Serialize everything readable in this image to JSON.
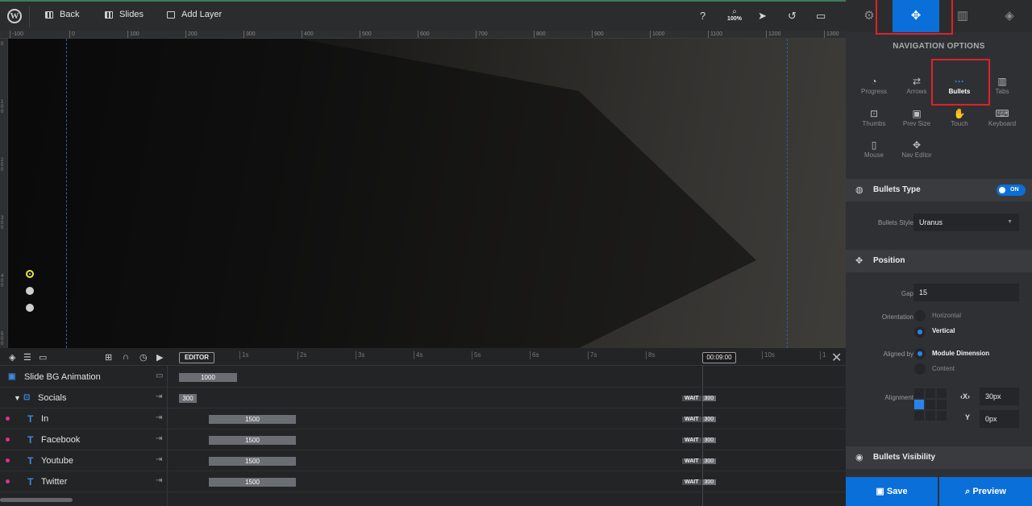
{
  "toolbar": {
    "wp_logo": "W",
    "back_label": "Back",
    "slides_label": "Slides",
    "add_layer_label": "Add Layer",
    "zoom_label": "100%"
  },
  "ruler": {
    "top_ticks": [
      "-100",
      "0",
      "100",
      "200",
      "300",
      "400",
      "500",
      "600",
      "700",
      "800",
      "900",
      "1000",
      "1100",
      "1200",
      "1300"
    ],
    "left_ticks": [
      "0",
      "100",
      "200",
      "300",
      "400",
      "500"
    ]
  },
  "canvas": {
    "bullets_count": 3
  },
  "timeline": {
    "editor_label": "EDITOR",
    "seconds": [
      "1s",
      "2s",
      "3s",
      "4s",
      "5s",
      "6s",
      "7s",
      "8s",
      "9s",
      "10s",
      "1"
    ],
    "current_time": "00:09:00",
    "rows": [
      {
        "name": "Slide BG Animation",
        "bar": "1000"
      },
      {
        "name": "Socials",
        "bar": "300",
        "wait": "WAIT",
        "wait_value": "300"
      },
      {
        "name": "In",
        "bar": "1500",
        "wait": "WAIT",
        "wait_value": "300"
      },
      {
        "name": "Facebook",
        "bar": "1500",
        "wait": "WAIT",
        "wait_value": "300"
      },
      {
        "name": "Youtube",
        "bar": "1500",
        "wait": "WAIT",
        "wait_value": "300"
      },
      {
        "name": "Twitter",
        "bar": "1500",
        "wait": "WAIT",
        "wait_value": "300"
      }
    ]
  },
  "panel": {
    "title": "NAVIGATION OPTIONS",
    "options": [
      "Progress",
      "Arrows",
      "Bullets",
      "Tabs",
      "Thumbs",
      "Prev Size",
      "Touch",
      "Keyboard",
      "Mouse",
      "Nav Editor"
    ],
    "bullets_type": {
      "title": "Bullets Type",
      "toggle": "ON",
      "style_label": "Bullets Style",
      "style_value": "Uranus"
    },
    "position": {
      "title": "Position",
      "gap_label": "Gap",
      "gap_value": "15",
      "orientation_label": "Orientation",
      "horizontal": "Horizontal",
      "vertical": "Vertical",
      "aligned_label": "Aligned by",
      "module_dimension": "Module Dimension",
      "content": "Content",
      "alignment_label": "Alignment",
      "x_label": "X",
      "x_value": "30px",
      "y_label": "Y",
      "y_value": "0px"
    },
    "visibility_title": "Bullets Visibility",
    "save_label": "Save",
    "preview_label": "Preview"
  },
  "colors": {
    "accent": "#0a6fd8",
    "highlight": "#e0212a",
    "bullet_active": "#e3e84a",
    "layer_dot": "#e0318a"
  }
}
